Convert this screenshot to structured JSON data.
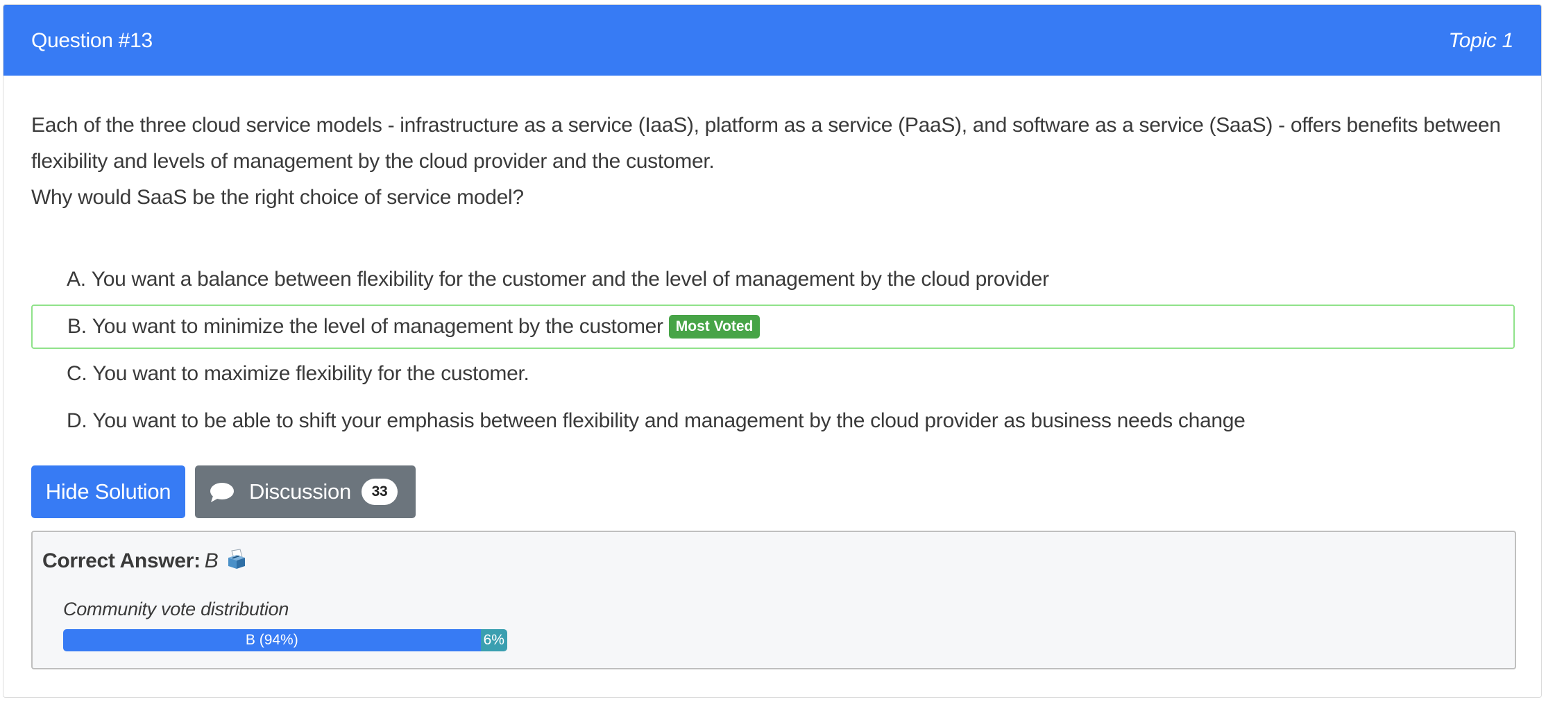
{
  "header": {
    "question": "Question #13",
    "topic": "Topic 1"
  },
  "question": {
    "line1": "Each of the three cloud service models - infrastructure as a service (IaaS), platform as a service (PaaS), and software as a service (SaaS) - offers benefits between",
    "line2": "flexibility and levels of management by the cloud provider and the customer.",
    "line3": "Why would SaaS be the right choice of service model?"
  },
  "choices": [
    {
      "letter": "A.",
      "text": "You want a balance between flexibility for the customer and the level of management by the cloud provider"
    },
    {
      "letter": "B.",
      "text": "You want to minimize the level of management by the customer",
      "badge": "Most Voted"
    },
    {
      "letter": "C.",
      "text": "You want to maximize flexibility for the customer."
    },
    {
      "letter": "D.",
      "text": "You want to be able to shift your emphasis between flexibility and management by the cloud provider as business needs change"
    }
  ],
  "buttons": {
    "hide_solution": "Hide Solution",
    "discussion": "Discussion",
    "discussion_count": "33",
    "discussion_icon": "chat-bubble-icon"
  },
  "answer": {
    "label": "Correct Answer:",
    "value": "B",
    "icon": "ballot-box-icon",
    "vote_title": "Community vote distribution",
    "votes": [
      {
        "label": "B (94%)",
        "percent": 94
      },
      {
        "label": "6%",
        "percent": 6
      }
    ]
  },
  "colors": {
    "primary": "#377bf4",
    "secondary": "#6c757d",
    "success": "#47a447",
    "voted_border": "#90e28a",
    "minor_vote": "#3a9fb0"
  }
}
